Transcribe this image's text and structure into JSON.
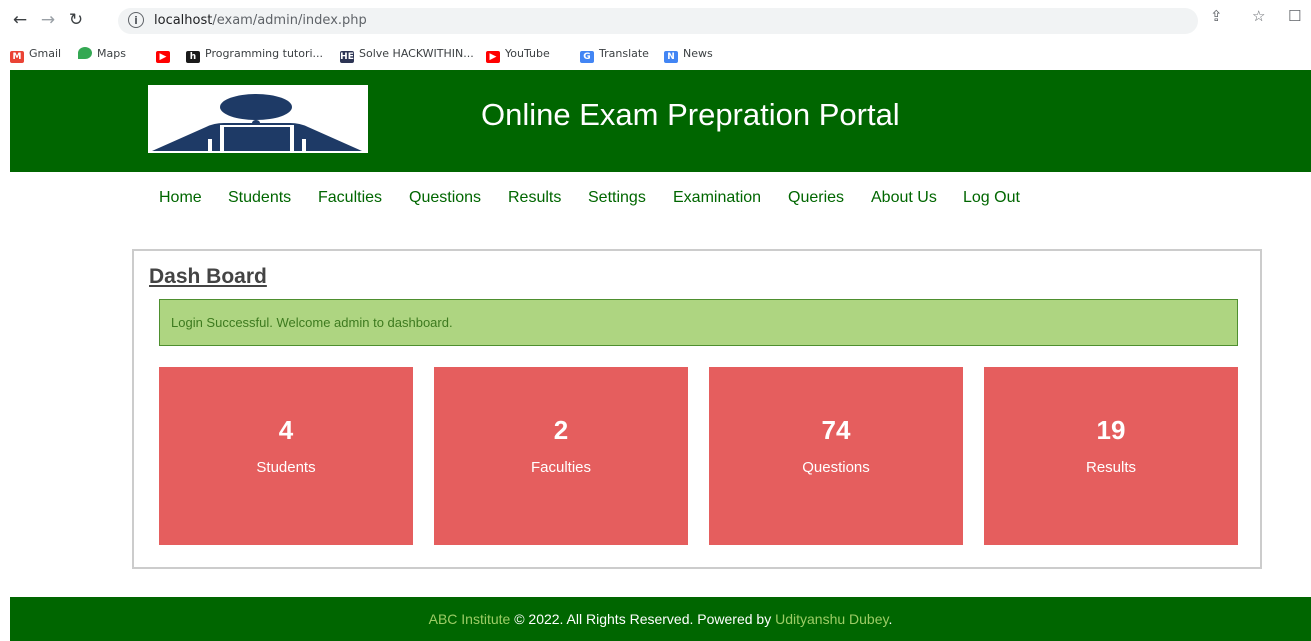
{
  "browser": {
    "url_host": "localhost",
    "url_path": "/exam/admin/index.php",
    "bookmarks": [
      {
        "label": "Gmail",
        "icon": "gmail-icon",
        "color": "#ea4335"
      },
      {
        "label": "Maps",
        "icon": "maps-pin-icon",
        "color": "#34a853"
      },
      {
        "label": "",
        "icon": "youtube-icon",
        "color": "#ff0000"
      },
      {
        "label": "Programming tutori...",
        "icon": "h-logo-icon",
        "color": "#1a1a1a"
      },
      {
        "label": "Solve HACKWITHIN...",
        "icon": "hackerearth-icon",
        "color": "#2c3454"
      },
      {
        "label": "YouTube",
        "icon": "youtube-icon",
        "color": "#ff0000"
      },
      {
        "label": "Translate",
        "icon": "translate-icon",
        "color": "#4285f4"
      },
      {
        "label": "News",
        "icon": "news-icon",
        "color": "#4285f4"
      }
    ]
  },
  "header": {
    "title": "Online Exam Prepration Portal",
    "background": "#006600"
  },
  "menu": [
    {
      "label": "Home"
    },
    {
      "label": "Students"
    },
    {
      "label": "Faculties"
    },
    {
      "label": "Questions"
    },
    {
      "label": "Results"
    },
    {
      "label": "Settings"
    },
    {
      "label": "Examination"
    },
    {
      "label": "Queries"
    },
    {
      "label": "About Us"
    },
    {
      "label": "Log Out"
    }
  ],
  "dashboard": {
    "title": "Dash Board",
    "alert": "Login Successful. Welcome admin to dashboard.",
    "cards": [
      {
        "count": "4",
        "label": "Students"
      },
      {
        "count": "2",
        "label": "Faculties"
      },
      {
        "count": "74",
        "label": "Questions"
      },
      {
        "count": "19",
        "label": "Results"
      }
    ],
    "card_color": "#e55e5e",
    "alert_color": "#aed581"
  },
  "footer": {
    "org": "ABC Institute",
    "copyright": " © 2022. All Rights Reserved. Powered by ",
    "author": "Udityanshu Dubey",
    "end": "."
  }
}
